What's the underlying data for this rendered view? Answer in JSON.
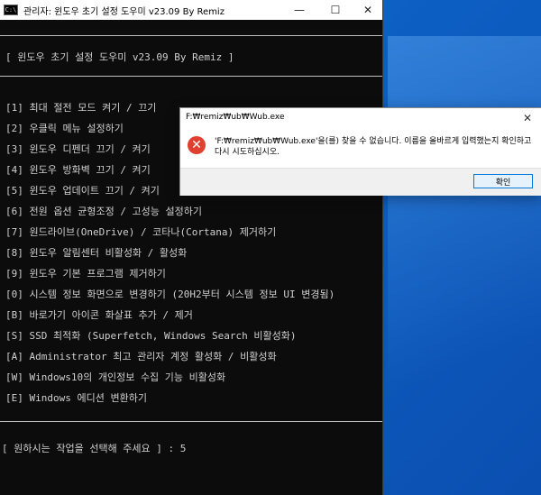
{
  "console": {
    "title": "관리자:  윈도우 초기 설정 도우미 v23.09 By Remiz",
    "header": "[ 윈도우 초기 설정 도우미 v23.09 By Remiz ]",
    "menu": [
      "[1] 최대 절전 모드 켜기 / 끄기",
      "[2] 우클릭 메뉴 설정하기",
      "[3] 윈도우 디펜더 끄기 / 켜기",
      "[4] 윈도우 방화벽 끄기 / 켜기",
      "[5] 윈도우 업데이트 끄기 / 켜기",
      "[6] 전원 옵션 균형조정 / 고성능 설정하기",
      "[7] 원드라이브(OneDrive) / 코타나(Cortana) 제거하기",
      "[8] 윈도우 알림센터 비활성화 / 활성화",
      "[9] 윈도우 기본 프로그램 제거하기",
      "[0] 시스템 정보 화면으로 변경하기 (20H2부터 시스템 정보 UI 변경됨)",
      "[B] 바로가기 아이콘 화살표 추가 / 제거",
      "[S] SSD 최적화 (Superfetch, Windows Search 비활성화)",
      "[A] Administrator 최고 관리자 계정 활성화 / 비활성화",
      "[W] Windows10의 개인정보 수집 기능 비활성화",
      "[E] Windows 에디션 변환하기"
    ],
    "prompt": "[ 원하시는 작업을 선택해 주세요 ] : 5"
  },
  "dialog": {
    "title": "F:₩remiz₩ub₩Wub.exe",
    "message": "'F:₩remiz₩ub₩Wub.exe'을(를) 찾을 수 없습니다. 이름을 올바르게 입력했는지 확인하고 다시 시도하십시오.",
    "ok_label": "확인",
    "close_glyph": "✕"
  },
  "window_controls": {
    "minimize": "—",
    "maximize": "☐",
    "close": "✕"
  },
  "icons": {
    "console": "console-icon",
    "error": "error-icon"
  },
  "colors": {
    "console_bg": "#0c0c0c",
    "console_text": "#cfcfcf",
    "error_red": "#e0402f",
    "accent": "#0078d7"
  }
}
